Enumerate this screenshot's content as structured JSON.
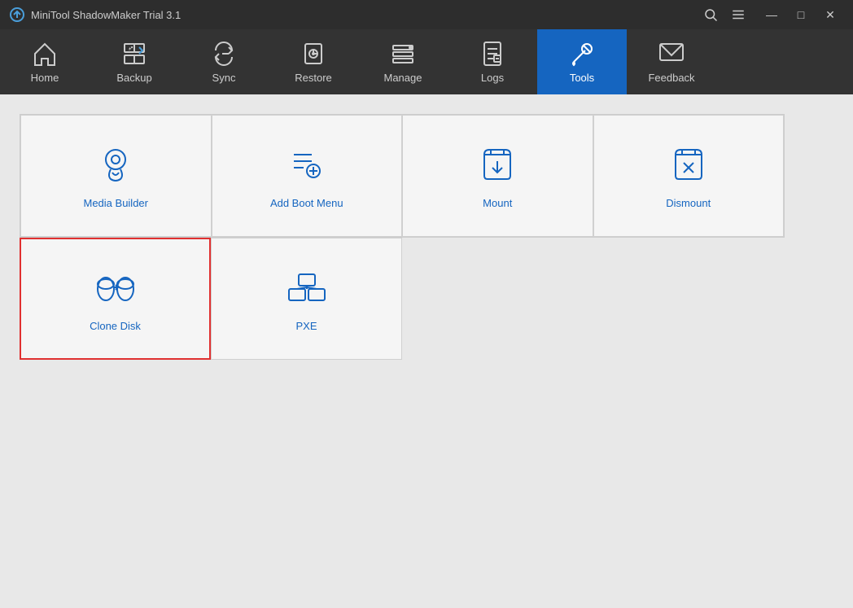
{
  "titleBar": {
    "appName": "MiniTool ShadowMaker Trial 3.1"
  },
  "navbar": {
    "items": [
      {
        "id": "home",
        "label": "Home",
        "active": false
      },
      {
        "id": "backup",
        "label": "Backup",
        "active": false
      },
      {
        "id": "sync",
        "label": "Sync",
        "active": false
      },
      {
        "id": "restore",
        "label": "Restore",
        "active": false
      },
      {
        "id": "manage",
        "label": "Manage",
        "active": false
      },
      {
        "id": "logs",
        "label": "Logs",
        "active": false
      },
      {
        "id": "tools",
        "label": "Tools",
        "active": true
      },
      {
        "id": "feedback",
        "label": "Feedback",
        "active": false
      }
    ]
  },
  "tools": {
    "row1": [
      {
        "id": "media-builder",
        "label": "Media Builder"
      },
      {
        "id": "add-boot-menu",
        "label": "Add Boot Menu"
      },
      {
        "id": "mount",
        "label": "Mount"
      },
      {
        "id": "dismount",
        "label": "Dismount"
      }
    ],
    "row2": [
      {
        "id": "clone-disk",
        "label": "Clone Disk",
        "selected": true
      },
      {
        "id": "pxe",
        "label": "PXE"
      }
    ]
  },
  "windowControls": {
    "minimize": "—",
    "maximize": "□",
    "close": "✕"
  }
}
